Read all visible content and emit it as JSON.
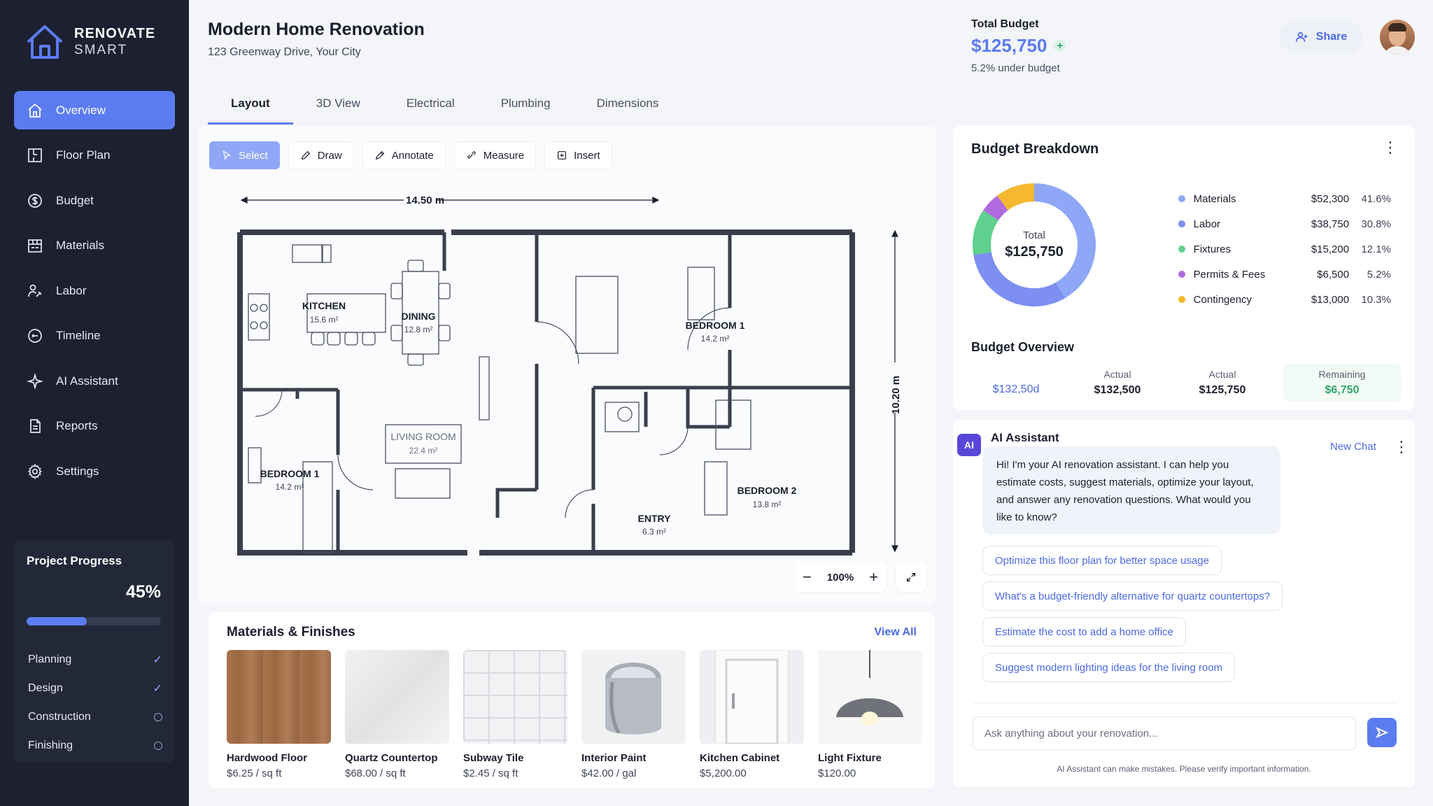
{
  "brand": {
    "line1": "RENOVATE",
    "line2": "SMART"
  },
  "nav": [
    {
      "label": "Overview",
      "icon": "home-icon"
    },
    {
      "label": "Floor Plan",
      "icon": "floor-plan-icon"
    },
    {
      "label": "Budget",
      "icon": "dollar-icon"
    },
    {
      "label": "Materials",
      "icon": "materials-icon"
    },
    {
      "label": "Labor",
      "icon": "labor-icon"
    },
    {
      "label": "Timeline",
      "icon": "timeline-icon"
    },
    {
      "label": "AI Assistant",
      "icon": "ai-sparkle-icon"
    },
    {
      "label": "Reports",
      "icon": "reports-icon"
    },
    {
      "label": "Settings",
      "icon": "gear-icon"
    }
  ],
  "progress": {
    "title": "Project Progress",
    "percent_label": "45%",
    "fraction": 0.45,
    "phases": [
      {
        "label": "Planning",
        "done": true
      },
      {
        "label": "Design",
        "done": true
      },
      {
        "label": "Construction",
        "done": false
      },
      {
        "label": "Finishing",
        "done": false
      }
    ]
  },
  "header": {
    "title": "Modern Home Renovation",
    "address": "123 Greenway Drive, Your City"
  },
  "tabs": [
    "Layout",
    "3D View",
    "Electrical",
    "Plumbing",
    "Dimensions"
  ],
  "budget_top": {
    "label": "Total Budget",
    "value": "$125,750",
    "sub": "5.2% under budget"
  },
  "share": {
    "label": "Share"
  },
  "toolbar": [
    "Select",
    "Draw",
    "Annotate",
    "Measure",
    "Insert"
  ],
  "plan": {
    "width_label": "14.50 m",
    "height_label": "10.20 m",
    "rooms": [
      {
        "name": "KITCHEN",
        "area": "15.6 m²"
      },
      {
        "name": "DINING",
        "area": "12.8 m²"
      },
      {
        "name": "BEDROOM 1",
        "area": "14.2 m²"
      },
      {
        "name": "LIVING ROOM",
        "area": "22.4 m²"
      },
      {
        "name": "BEDROOM 1",
        "area": "14.2 m²"
      },
      {
        "name": "BEDROOM 2",
        "area": "13.8 m²"
      },
      {
        "name": "ENTRY",
        "area": "6.3 m²"
      }
    ],
    "zoom": "100%"
  },
  "materials": {
    "title": "Materials & Finishes",
    "view_all": "View All",
    "items": [
      {
        "name": "Hardwood Floor",
        "price": "$6.25 / sq ft"
      },
      {
        "name": "Quartz Countertop",
        "price": "$68.00 / sq ft"
      },
      {
        "name": "Subway Tile",
        "price": "$2.45 / sq ft"
      },
      {
        "name": "Interior Paint",
        "price": "$42.00 / gal"
      },
      {
        "name": "Kitchen Cabinet",
        "price": "$5,200.00"
      },
      {
        "name": "Light Fixture",
        "price": "$120.00"
      }
    ]
  },
  "breakdown": {
    "title": "Budget Breakdown",
    "center_label": "Total",
    "center_value": "$125,750",
    "items": [
      {
        "name": "Materials",
        "amount": "$52,300",
        "pct": "41.6%",
        "value": 41.6,
        "color": "#8ea7f6"
      },
      {
        "name": "Labor",
        "amount": "$38,750",
        "pct": "30.8%",
        "value": 30.8,
        "color": "#7d8ff0"
      },
      {
        "name": "Fixtures",
        "amount": "$15,200",
        "pct": "12.1%",
        "value": 12.1,
        "color": "#5fd08e"
      },
      {
        "name": "Permits & Fees",
        "amount": "$6,500",
        "pct": "5.2%",
        "value": 5.2,
        "color": "#b06be0"
      },
      {
        "name": "Contingency",
        "amount": "$13,000",
        "pct": "10.3%",
        "value": 10.3,
        "color": "#f5b830"
      }
    ]
  },
  "overview": {
    "title": "Budget Overview",
    "cells": [
      {
        "label": "",
        "value": "$132,50d"
      },
      {
        "label": "Actual",
        "value": "$132,500"
      },
      {
        "label": "Actual",
        "value": "$125,750"
      },
      {
        "label": "Remaining",
        "value": "$6,750"
      }
    ]
  },
  "ai": {
    "badge": "AI",
    "title": "AI Assistant",
    "new_chat": "New Chat",
    "message": "Hi! I'm your AI renovation assistant. I can help you estimate costs, suggest materials, optimize your layout, and answer any renovation questions. What would you like to know?",
    "suggestions": [
      "Optimize this floor plan for better space usage",
      "What's a budget-friendly alternative for quartz countertops?",
      "Estimate the cost to add a home office",
      "Suggest modern lighting ideas for the living room"
    ],
    "placeholder": "Ask anything about your renovation...",
    "disclaimer": "AI Assistant can make mistakes. Please verify important information."
  }
}
